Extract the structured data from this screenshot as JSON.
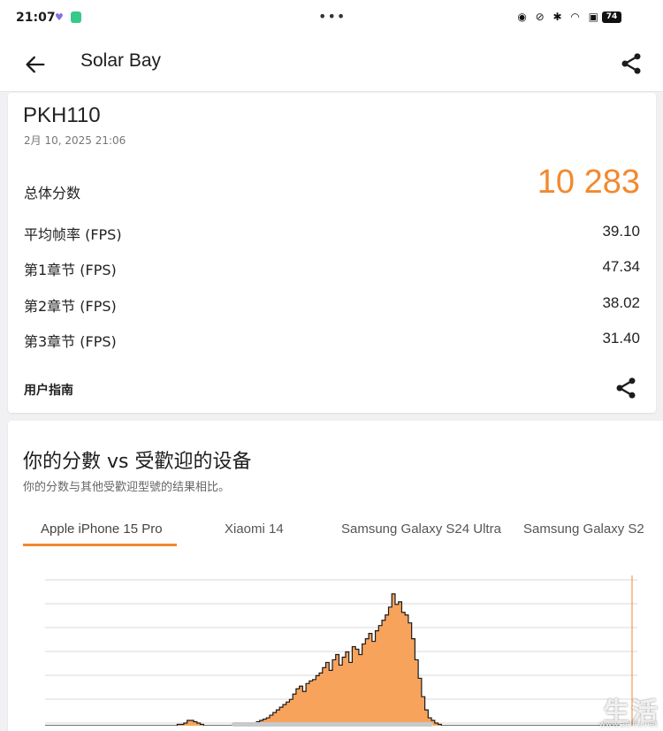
{
  "status_bar": {
    "time": "21:07",
    "right_icons": [
      "alarm-icon",
      "mute-icon",
      "bluetooth-icon",
      "wifi-icon",
      "signal-icon"
    ],
    "battery": "74"
  },
  "app_bar": {
    "title": "Solar Bay"
  },
  "result": {
    "device": "PKH110",
    "date": "2月 10, 2025 21:06",
    "score_label": "总体分数",
    "score_value": "10 283",
    "rows": [
      {
        "label": "平均帧率 (FPS)",
        "value": "39.10"
      },
      {
        "label": "第1章节 (FPS)",
        "value": "47.34"
      },
      {
        "label": "第2章节 (FPS)",
        "value": "38.02"
      },
      {
        "label": "第3章节 (FPS)",
        "value": "31.40"
      }
    ],
    "guide_label": "用户指南"
  },
  "comparison": {
    "title": "你的分數 vs 受歡迎的设备",
    "subtitle": "你的分数与其他受歡迎型號的结果相比。",
    "tabs": [
      {
        "label": "Apple iPhone 15 Pro",
        "active": true
      },
      {
        "label": "Xiaomi 14",
        "active": false
      },
      {
        "label": "Samsung Galaxy S24 Ultra",
        "active": false
      },
      {
        "label": "Samsung Galaxy S2",
        "active": false
      }
    ]
  },
  "chart_data": {
    "type": "area",
    "series": [
      {
        "values": [
          0,
          0,
          0,
          0,
          0,
          0,
          0,
          0,
          0,
          0,
          0,
          0,
          0,
          0,
          0,
          0,
          0,
          0,
          0,
          0,
          0,
          0,
          0,
          0,
          0,
          0,
          0,
          0,
          0,
          0,
          0,
          0,
          0,
          0,
          0,
          0,
          0,
          0,
          0,
          0,
          1,
          1,
          2,
          4,
          4,
          3,
          2,
          1,
          0,
          0,
          0,
          0,
          0,
          0,
          0,
          0,
          0,
          0,
          0,
          0,
          0,
          0,
          1,
          2,
          3,
          4,
          5,
          6,
          8,
          10,
          12,
          14,
          16,
          18,
          20,
          24,
          28,
          30,
          26,
          32,
          34,
          35,
          38,
          40,
          44,
          48,
          42,
          50,
          54,
          46,
          52,
          56,
          48,
          60,
          58,
          54,
          62,
          66,
          70,
          64,
          72,
          76,
          80,
          84,
          90,
          100,
          92,
          94,
          86,
          84,
          78,
          66,
          50,
          36,
          22,
          12,
          6,
          4,
          2,
          1,
          0,
          0,
          0,
          0,
          0,
          0,
          0,
          0,
          0,
          0,
          0,
          0,
          0,
          0,
          0,
          0,
          0,
          0,
          0,
          0,
          0,
          0,
          0,
          0,
          0,
          0,
          0,
          0,
          0,
          0,
          0,
          0,
          0,
          0,
          0,
          0,
          0,
          0,
          0,
          0,
          0,
          0,
          0,
          0,
          0,
          0,
          0,
          0,
          0,
          0,
          0,
          0,
          0,
          0
        ]
      }
    ],
    "ylim": [
      0,
      110
    ],
    "colors": {
      "fill": "#f7a35c",
      "line": "#1a1a1a",
      "grid": "#d9d9d9",
      "marker": "#f2892e"
    }
  },
  "watermark": {
    "text": "生活",
    "url": "www.aelife.net"
  }
}
